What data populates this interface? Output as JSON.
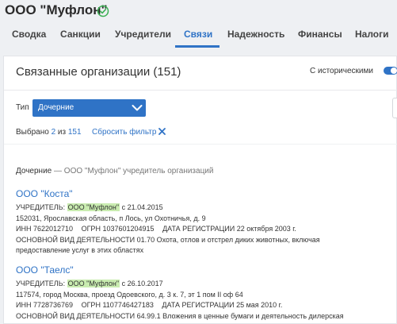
{
  "header": {
    "company_name": "ООО \"Муфлон\"",
    "verified_color": "#3cb054"
  },
  "tabs": [
    {
      "label": "Сводка",
      "active": false
    },
    {
      "label": "Санкции",
      "active": false
    },
    {
      "label": "Учредители",
      "active": false
    },
    {
      "label": "Связи",
      "active": true
    },
    {
      "label": "Надежность",
      "active": false
    },
    {
      "label": "Финансы",
      "active": false
    },
    {
      "label": "Налоги",
      "active": false
    }
  ],
  "panel": {
    "title": "Связанные организации (151)",
    "historical_label": "С историческими",
    "historical_enabled": true,
    "type_label": "Тип",
    "type_value": "Дочерние",
    "selected_prefix": "Выбрано",
    "selected_count": "2",
    "selected_of": "из",
    "selected_total": "151",
    "reset_label": "Сбросить фильтр"
  },
  "section": {
    "name": "Дочерние",
    "description": "— ООО \"Муфлон\" учредитель организаций"
  },
  "organizations": [
    {
      "name": "ООО \"Коста\"",
      "founder_label": "УЧРЕДИТЕЛЬ:",
      "founder_name": "ООО \"Муфлон\"",
      "founder_since": "с 21.04.2015",
      "address": "152031, Ярославская область, п Лось, ул Охотничья, д. 9",
      "inn_label": "ИНН",
      "inn": "7622012710",
      "ogrn_label": "ОГРН",
      "ogrn": "1037601204915",
      "reg_label": "ДАТА РЕГИСТРАЦИИ",
      "reg_date": "22 октября 2003 г.",
      "activity_label": "ОСНОВНОЙ ВИД ДЕЯТЕЛЬНОСТИ",
      "activity_1": "01.70 Охота, отлов и отстрел диких животных, включая",
      "activity_2": "предоставление услуг в этих областях"
    },
    {
      "name": "ООО \"Таелс\"",
      "founder_label": "УЧРЕДИТЕЛЬ:",
      "founder_name": "ООО \"Муфлон\"",
      "founder_since": "с 26.10.2017",
      "address": "117574, город Москва, проезд Одоевского, д. 3 к. 7, эт 1 пом II оф 64",
      "inn_label": "ИНН",
      "inn": "7728736769",
      "ogrn_label": "ОГРН",
      "ogrn": "1107746427183",
      "reg_label": "ДАТА РЕГИСТРАЦИИ",
      "reg_date": "25 мая 2010 г.",
      "activity_label": "ОСНОВНОЙ ВИД ДЕЯТЕЛЬНОСТИ",
      "activity_1": "64.99.1 Вложения в ценные бумаги и деятельность дилерская",
      "activity_2": ""
    }
  ],
  "colors": {
    "accent": "#2f73c6",
    "highlight": "#c9ecb0"
  }
}
